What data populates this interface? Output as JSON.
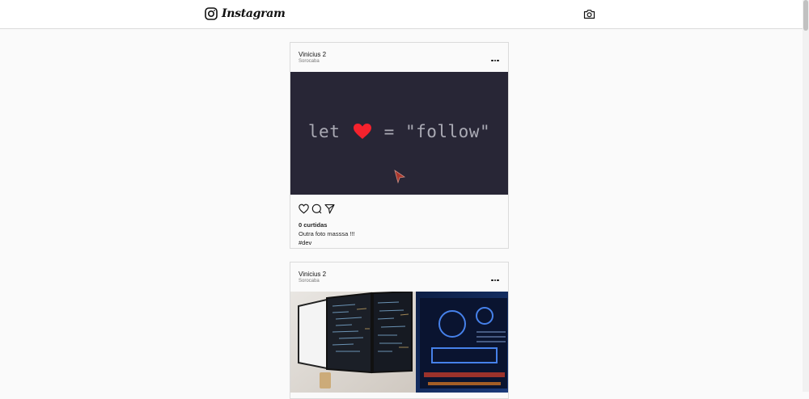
{
  "app": {
    "title": "Instagram"
  },
  "header": {
    "logo_text": "Instagram",
    "camera_icon": "camera-icon"
  },
  "posts": [
    {
      "username": "Vinicius 2",
      "location": "Sorocaba",
      "image_code_before": "let",
      "image_code_after": "= \"follow\"",
      "likes": "0 curtidas",
      "caption": "Outra foto masssa !!!",
      "tags": "#dev"
    },
    {
      "username": "Vinicius 2",
      "location": "Sorocaba"
    }
  ],
  "colors": {
    "heart": "#f5222d",
    "image1_bg": "#282636",
    "border": "#dbdbdb"
  }
}
